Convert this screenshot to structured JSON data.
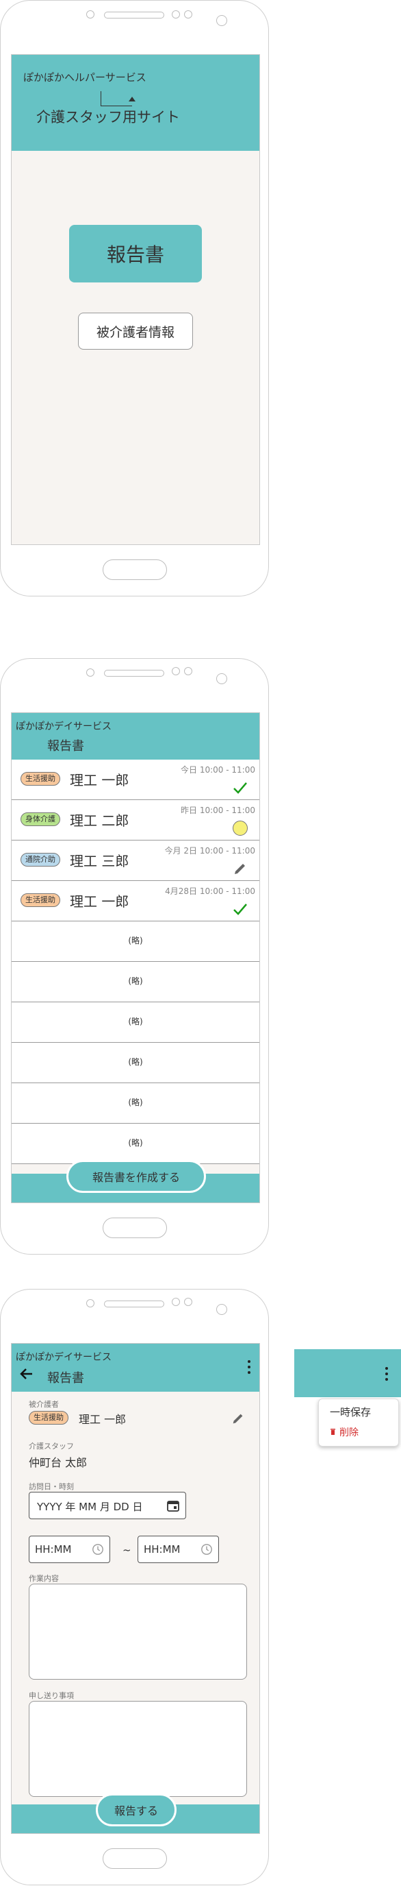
{
  "screen1": {
    "company": "ぽかぽかヘルパーサービス",
    "site_title": "介護スタッフ用サイト",
    "report_button": "報告書",
    "care_receiver_button": "被介護者情報"
  },
  "screen2": {
    "company": "ぽかぽかデイサービス",
    "title": "報告書",
    "rows": [
      {
        "badge": "生活援助",
        "name": "理工 一郎",
        "time": "今日 10:00 - 11:00",
        "status": "check-icon"
      },
      {
        "badge": "身体介護",
        "name": "理工 二郎",
        "time": "昨日 10:00 - 11:00",
        "status": "yellow-circle-icon"
      },
      {
        "badge": "通院介助",
        "name": "理工 三郎",
        "time": "今月 2日 10:00 - 11:00",
        "status": "pencil-icon"
      },
      {
        "badge": "生活援助",
        "name": "理工 一郎",
        "time": "4月28日 10:00 - 11:00",
        "status": "check-icon"
      }
    ],
    "omitted_label": "(略)",
    "create_button": "報告書を作成する"
  },
  "screen3": {
    "company": "ぽかぽかデイサービス",
    "title": "報告書",
    "care_receiver_label": "被介護者",
    "care_receiver_badge": "生活援助",
    "care_receiver_name": "理工 一郎",
    "staff_label": "介護スタッフ",
    "staff_name": "仲町台 太郎",
    "visit_label": "訪問日・時刻",
    "date_placeholder": "YYYY 年 MM 月 DD 日",
    "time_start_placeholder": "HH:MM",
    "tilde": "~",
    "time_end_placeholder": "HH:MM",
    "work_label": "作業内容",
    "handover_label": "申し送り事項",
    "submit_button": "報告する"
  },
  "menu": {
    "save_label": "一時保存",
    "delete_label": "削除"
  },
  "colors": {
    "accent": "#66c2c4",
    "screen_bg": "#f7f4f1",
    "delete": "#d32f2f"
  }
}
